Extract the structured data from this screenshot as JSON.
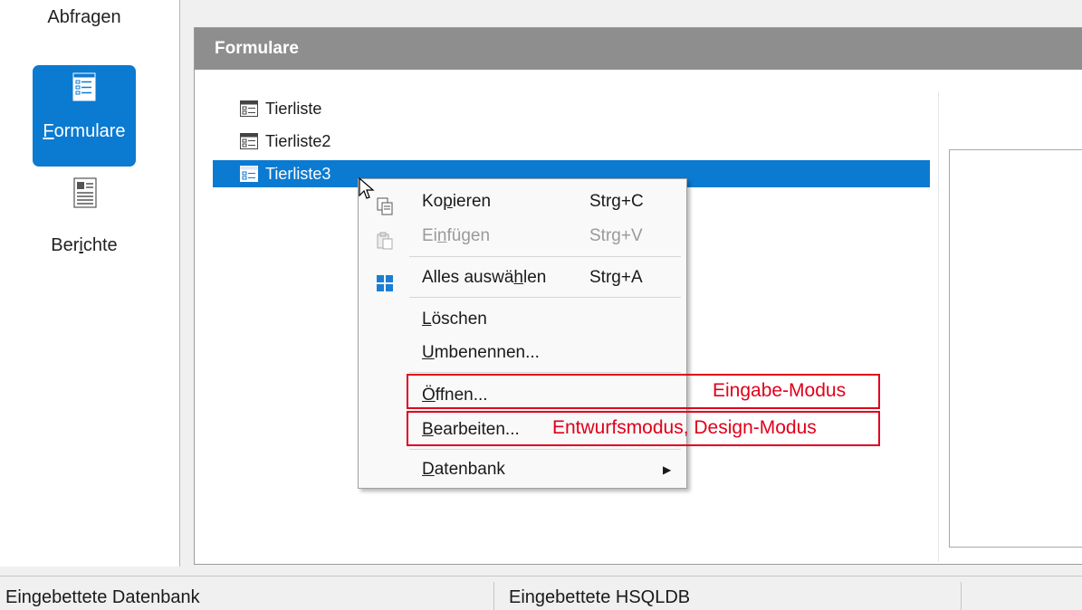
{
  "sidebar": {
    "items": [
      {
        "label": "Abfragen",
        "underline": "g"
      },
      {
        "label": "Formulare",
        "underline": "F",
        "selected": true,
        "icon": "form-icon"
      },
      {
        "label": "Berichte",
        "underline": "i",
        "icon": "report-icon"
      }
    ]
  },
  "panel": {
    "title": "Formulare",
    "items": [
      {
        "label": "Tierliste",
        "icon": "form-doc-icon"
      },
      {
        "label": "Tierliste2",
        "icon": "form-doc-icon"
      },
      {
        "label": "Tierliste3",
        "icon": "form-doc-icon",
        "selected": true
      }
    ]
  },
  "context_menu": {
    "items": [
      {
        "label_pre": "Ko",
        "label_u": "p",
        "label_post": "ieren",
        "shortcut": "Strg+C",
        "icon": "copy-icon",
        "enabled": true
      },
      {
        "label_pre": "Ei",
        "label_u": "n",
        "label_post": "fügen",
        "shortcut": "Strg+V",
        "icon": "paste-icon",
        "enabled": false
      },
      {
        "label_pre": "Alles auswä",
        "label_u": "h",
        "label_post": "len",
        "shortcut": "Strg+A",
        "icon": "select-all-icon",
        "enabled": true
      },
      {
        "label_pre": "",
        "label_u": "L",
        "label_post": "öschen",
        "shortcut": "",
        "enabled": true
      },
      {
        "label_pre": "",
        "label_u": "U",
        "label_post": "mbenennen...",
        "shortcut": "",
        "enabled": true
      },
      {
        "label_pre": "",
        "label_u": "Ö",
        "label_post": "ffnen...",
        "shortcut": "",
        "enabled": true
      },
      {
        "label_pre": "",
        "label_u": "B",
        "label_post": "earbeiten...",
        "shortcut": "",
        "enabled": true
      },
      {
        "label_pre": "",
        "label_u": "D",
        "label_post": "atenbank",
        "shortcut": "",
        "enabled": true,
        "submenu": "chevron-right-icon"
      }
    ]
  },
  "annotations": {
    "open": "Eingabe-Modus",
    "edit": "Entwurfsmodus, Design-Modus"
  },
  "statusbar": {
    "left": "Eingebettete Datenbank",
    "middle": "Eingebettete HSQLDB"
  },
  "colors": {
    "selection": "#0b7ad1",
    "header": "#8e8e8e",
    "annotation": "#e0001a"
  }
}
